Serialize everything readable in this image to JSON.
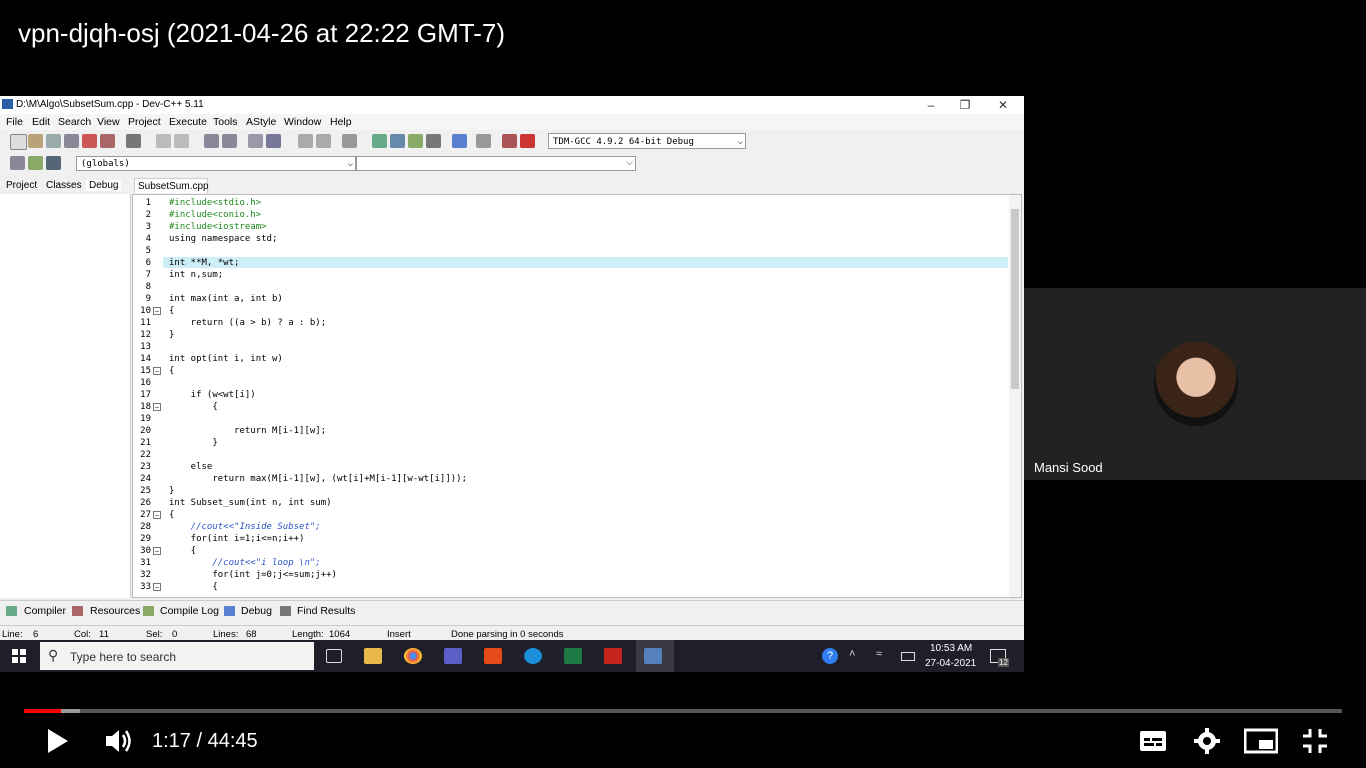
{
  "video": {
    "title": "vpn-djqh-osj (2021-04-26 at 22:22 GMT-7)",
    "time_display": "1:17 / 44:45",
    "progress": {
      "played_fraction": 0.0283,
      "buffered_fraction": 0.0425
    }
  },
  "devcpp": {
    "window_title": "D:\\M\\Algo\\SubsetSum.cpp - Dev-C++ 5.11",
    "menu": [
      "File",
      "Edit",
      "Search",
      "View",
      "Project",
      "Execute",
      "Tools",
      "AStyle",
      "Window",
      "Help"
    ],
    "compiler": "TDM-GCC 4.9.2 64-bit Debug",
    "scope_select": "(globals)",
    "left_tabs": [
      "Project",
      "Classes",
      "Debug"
    ],
    "file_tab": "SubsetSum.cpp",
    "code_lines": [
      "#include<stdio.h>",
      "#include<conio.h>",
      "#include<iostream>",
      "using namespace std;",
      "",
      "int **M, *wt;",
      "int n,sum;",
      "",
      "int max(int a, int b)",
      "{",
      "    return ((a > b) ? a : b);",
      "}",
      "",
      "int opt(int i, int w)",
      "{",
      "",
      "    if (w<wt[i])",
      "        {",
      "",
      "            return M[i-1][w];",
      "        }",
      "",
      "    else",
      "        return max(M[i-1][w], (wt[i]+M[i-1][w-wt[i]]));",
      "}",
      "int Subset_sum(int n, int sum)",
      "{",
      "    //cout<<\"Inside Subset\";",
      "    for(int i=1;i<=n;i++)",
      "    {",
      "        //cout<<\"i loop \\n\";",
      "        for(int j=0;j<=sum;j++)",
      "        {"
    ],
    "bottom_tabs": [
      "Compiler",
      "Resources",
      "Compile Log",
      "Debug",
      "Find Results"
    ],
    "status": {
      "line": "Line:",
      "line_val": "6",
      "col": "Col:",
      "col_val": "11",
      "sel": "Sel:",
      "sel_val": "0",
      "lines": "Lines:",
      "lines_val": "68",
      "length": "Length:",
      "length_val": "1064",
      "mode": "Insert",
      "message": "Done parsing in 0 seconds"
    }
  },
  "taskbar": {
    "search_placeholder": "Type here to search",
    "time": "10:53 AM",
    "date": "27-04-2021",
    "notifications": "12"
  },
  "participant": {
    "name": "Mansi Sood"
  },
  "colors": {
    "highlight": "#cdeef7",
    "progress_red": "#ff0000",
    "taskbar": "#1f1f2a"
  }
}
